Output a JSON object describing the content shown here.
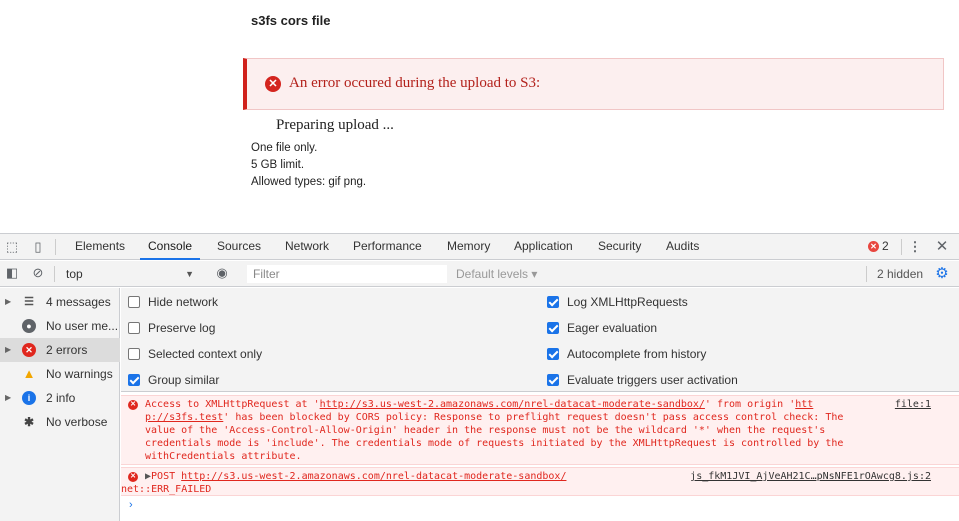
{
  "page": {
    "title": "s3fs cors file",
    "error_message": "An error occured during the upload to S3:",
    "status": "Preparing upload ...",
    "help": [
      "One file only.",
      "5 GB limit.",
      "Allowed types: gif png."
    ]
  },
  "devtools": {
    "tabs": [
      "Elements",
      "Console",
      "Sources",
      "Network",
      "Performance",
      "Memory",
      "Application",
      "Security",
      "Audits"
    ],
    "active_tab": "Console",
    "error_count": "2",
    "toolbar": {
      "context": "top",
      "filter_placeholder": "Filter",
      "levels": "Default levels ▾",
      "hidden": "2 hidden"
    },
    "sidebar": [
      {
        "label": "4 messages",
        "icon": "list-icon"
      },
      {
        "label": "No user me...",
        "icon": "user-icon"
      },
      {
        "label": "2 errors",
        "icon": "error-icon"
      },
      {
        "label": "No warnings",
        "icon": "warning-icon"
      },
      {
        "label": "2 info",
        "icon": "info-icon"
      },
      {
        "label": "No verbose",
        "icon": "bug-icon"
      }
    ],
    "settings": {
      "left": [
        {
          "label": "Hide network",
          "checked": false
        },
        {
          "label": "Preserve log",
          "checked": false
        },
        {
          "label": "Selected context only",
          "checked": false
        },
        {
          "label": "Group similar",
          "checked": true
        }
      ],
      "right": [
        {
          "label": "Log XMLHttpRequests",
          "checked": true
        },
        {
          "label": "Eager evaluation",
          "checked": true
        },
        {
          "label": "Autocomplete from history",
          "checked": true
        },
        {
          "label": "Evaluate triggers user activation",
          "checked": true
        }
      ]
    },
    "messages": [
      {
        "line1_a": "Access to XMLHttpRequest at '",
        "line1_url": "http://s3.us-west-2.amazonaws.com/nrel-datacat-moderate-sandbox/",
        "line1_b": "' from origin '",
        "line1_c": "htt",
        "line2_origin": "p://s3fs.test",
        "line2_b": "' has been blocked by CORS policy: Response to preflight request doesn't pass access control check: The",
        "line3": "value of the 'Access-Control-Allow-Origin' header in the response must not be the wildcard '*' when the request's",
        "line4": "credentials mode is 'include'. The credentials mode of requests initiated by the XMLHttpRequest is controlled by the",
        "line5": "withCredentials attribute.",
        "source": "file:1"
      },
      {
        "method": "POST",
        "url": "http://s3.us-west-2.amazonaws.com/nrel-datacat-moderate-sandbox/",
        "status": "net::ERR_FAILED",
        "source": "js_fkM1JVI_AjVeAH21C…pNsNFE1rOAwcg8.js:2"
      }
    ]
  }
}
